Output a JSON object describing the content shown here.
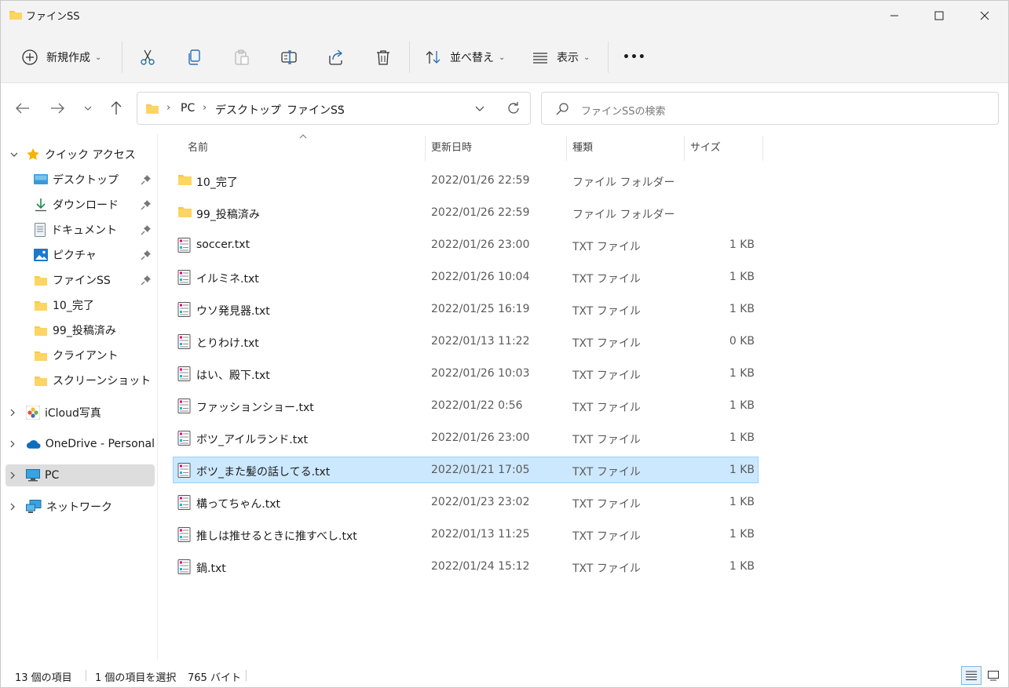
{
  "window": {
    "title": "ファインSS"
  },
  "toolbar": {
    "new_label": "新規作成",
    "sort_label": "並べ替え",
    "view_label": "表示",
    "more_label": "•••"
  },
  "address": {
    "crumbs": [
      "PC",
      "デスクトップ",
      "ファインSS"
    ],
    "search_placeholder": "ファインSSの検索"
  },
  "sidebar": {
    "quick_access": "クイック アクセス",
    "items": [
      {
        "label": "デスクトップ",
        "icon": "desktop-icon",
        "pinned": true
      },
      {
        "label": "ダウンロード",
        "icon": "download-icon",
        "pinned": true
      },
      {
        "label": "ドキュメント",
        "icon": "document-icon",
        "pinned": true
      },
      {
        "label": "ピクチャ",
        "icon": "pictures-icon",
        "pinned": true
      },
      {
        "label": "ファインSS",
        "icon": "folder-icon",
        "pinned": true
      },
      {
        "label": "10_完了",
        "icon": "folder-icon",
        "pinned": false
      },
      {
        "label": "99_投稿済み",
        "icon": "folder-icon",
        "pinned": false
      },
      {
        "label": "クライアント",
        "icon": "folder-icon",
        "pinned": false
      },
      {
        "label": "スクリーンショット",
        "icon": "folder-icon",
        "pinned": false
      }
    ],
    "roots": [
      {
        "label": "iCloud写真",
        "icon": "icloud-photos-icon"
      },
      {
        "label": "OneDrive - Personal",
        "icon": "onedrive-icon"
      },
      {
        "label": "PC",
        "icon": "pc-icon",
        "selected": true
      },
      {
        "label": "ネットワーク",
        "icon": "network-icon"
      }
    ]
  },
  "columns": {
    "name": "名前",
    "date": "更新日時",
    "type": "種類",
    "size": "サイズ"
  },
  "files": [
    {
      "name": "10_完了",
      "date": "2022/01/26 22:59",
      "type": "ファイル フォルダー",
      "size": "",
      "kind": "folder"
    },
    {
      "name": "99_投稿済み",
      "date": "2022/01/26 22:59",
      "type": "ファイル フォルダー",
      "size": "",
      "kind": "folder"
    },
    {
      "name": "soccer.txt",
      "date": "2022/01/26 23:00",
      "type": "TXT ファイル",
      "size": "1 KB",
      "kind": "txt"
    },
    {
      "name": "イルミネ.txt",
      "date": "2022/01/26 10:04",
      "type": "TXT ファイル",
      "size": "1 KB",
      "kind": "txt"
    },
    {
      "name": "ウソ発見器.txt",
      "date": "2022/01/25 16:19",
      "type": "TXT ファイル",
      "size": "1 KB",
      "kind": "txt"
    },
    {
      "name": "とりわけ.txt",
      "date": "2022/01/13 11:22",
      "type": "TXT ファイル",
      "size": "0 KB",
      "kind": "txt"
    },
    {
      "name": "はい、殿下.txt",
      "date": "2022/01/26 10:03",
      "type": "TXT ファイル",
      "size": "1 KB",
      "kind": "txt"
    },
    {
      "name": "ファッションショー.txt",
      "date": "2022/01/22 0:56",
      "type": "TXT ファイル",
      "size": "1 KB",
      "kind": "txt"
    },
    {
      "name": "ボツ_アイルランド.txt",
      "date": "2022/01/26 23:00",
      "type": "TXT ファイル",
      "size": "1 KB",
      "kind": "txt"
    },
    {
      "name": "ボツ_また髪の話してる.txt",
      "date": "2022/01/21 17:05",
      "type": "TXT ファイル",
      "size": "1 KB",
      "kind": "txt",
      "selected": true
    },
    {
      "name": "構ってちゃん.txt",
      "date": "2022/01/23 23:02",
      "type": "TXT ファイル",
      "size": "1 KB",
      "kind": "txt"
    },
    {
      "name": "推しは推せるときに推すべし.txt",
      "date": "2022/01/13 11:25",
      "type": "TXT ファイル",
      "size": "1 KB",
      "kind": "txt"
    },
    {
      "name": "鍋.txt",
      "date": "2022/01/24 15:12",
      "type": "TXT ファイル",
      "size": "1 KB",
      "kind": "txt"
    }
  ],
  "status": {
    "count": "13 個の項目",
    "selection": "1 個の項目を選択",
    "size": "765 バイト"
  },
  "colors": {
    "folder": "#f8c84a",
    "selection": "#cce8ff",
    "accent": "#0067c0"
  }
}
